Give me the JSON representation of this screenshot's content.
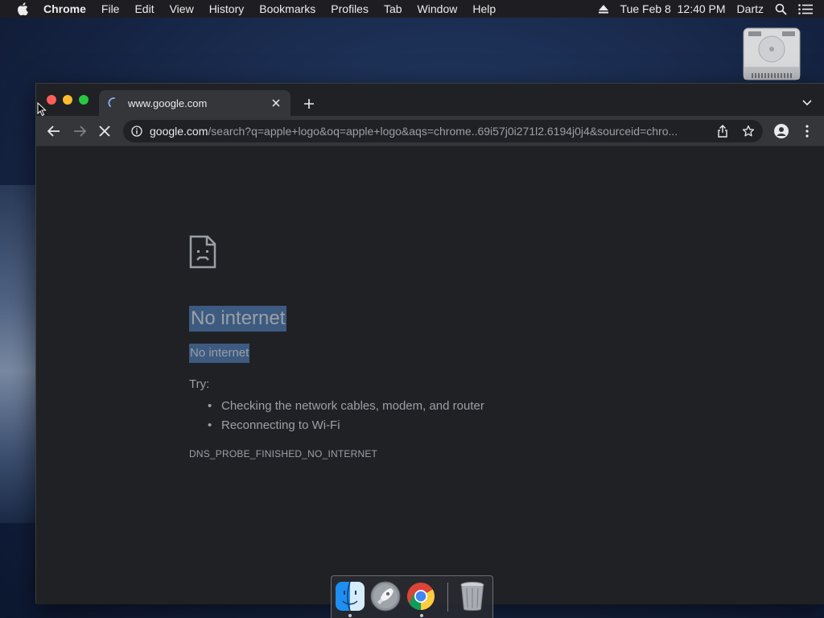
{
  "menubar": {
    "app_name": "Chrome",
    "items": [
      "File",
      "Edit",
      "View",
      "History",
      "Bookmarks",
      "Profiles",
      "Tab",
      "Window",
      "Help"
    ],
    "clock": "Tue Feb 8  12:40 PM",
    "user": "Dartz"
  },
  "browser": {
    "tab": {
      "title": "www.google.com",
      "loading": true
    },
    "omnibox": {
      "host": "google.com",
      "path": "/search?q=apple+logo&oq=apple+logo&aqs=chrome..69i57j0i271l2.6194j0j4&sourceid=chro..."
    }
  },
  "error_page": {
    "title": "No internet",
    "subtitle": "No internet",
    "try_label": "Try:",
    "suggestions": [
      "Checking the network cables, modem, and router",
      "Reconnecting to Wi-Fi"
    ],
    "error_code": "DNS_PROBE_FINISHED_NO_INTERNET"
  },
  "dock": {
    "items": [
      {
        "icon": "finder-icon",
        "running": true
      },
      {
        "icon": "launchpad-icon",
        "running": false
      },
      {
        "icon": "chrome-icon",
        "running": true
      },
      {
        "icon": "trash-icon",
        "running": false
      }
    ]
  },
  "colors": {
    "page_bg": "#202124",
    "toolbar_bg": "#35363a",
    "selection": "#3d5a80",
    "text_muted": "#9aa0a6"
  }
}
